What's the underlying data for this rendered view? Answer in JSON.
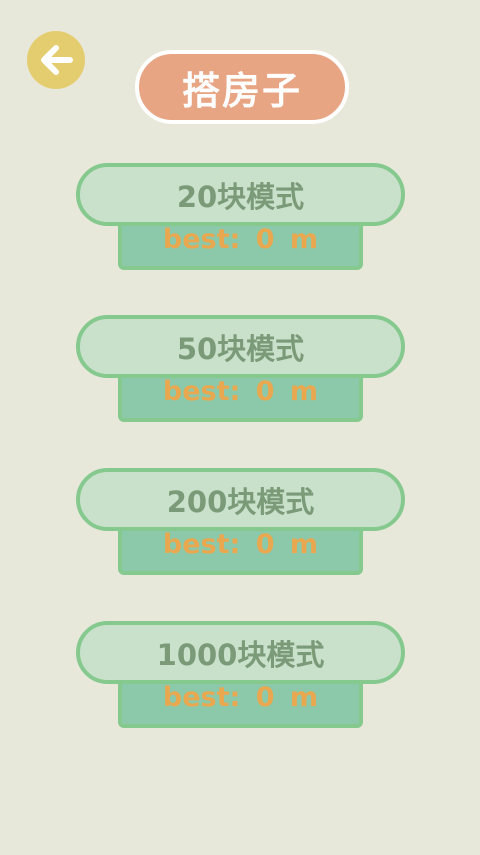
{
  "header": {
    "title": "搭房子",
    "back_icon": "arrow-left-icon"
  },
  "colors": {
    "background": "#e8e8da",
    "back_button": "#e3cd6e",
    "title_pill": "#e8a584",
    "mode_pill": "#c9e1cb",
    "mode_border": "#85c98f",
    "best_box": "#8cc9ab",
    "best_text": "#e9a84f",
    "mode_text": "#7a9a78"
  },
  "modes": [
    {
      "label": "20块模式",
      "best": "best:  0  m"
    },
    {
      "label": "50块模式",
      "best": "best:  0  m"
    },
    {
      "label": "200块模式",
      "best": "best:  0  m"
    },
    {
      "label": "1000块模式",
      "best": "best:  0  m"
    }
  ]
}
